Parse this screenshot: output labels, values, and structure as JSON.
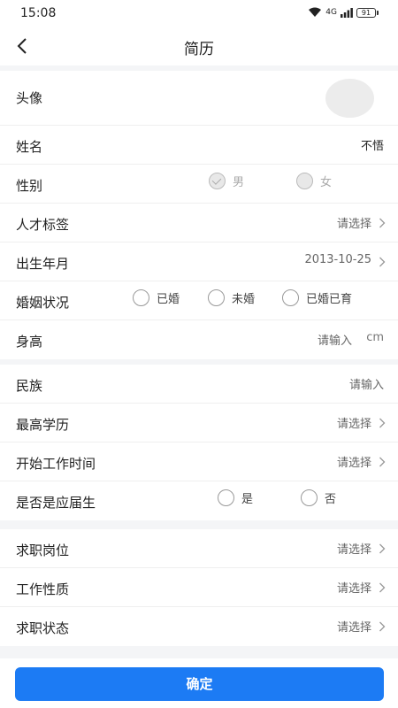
{
  "status_bar": {
    "time": "15:08",
    "network": "4G",
    "battery": "91"
  },
  "nav": {
    "title": "简历"
  },
  "basic": {
    "avatar_label": "头像",
    "name_label": "姓名",
    "name_value": "不悟",
    "gender_label": "性别",
    "gender_options": [
      "男",
      "女"
    ],
    "gender_selected": "男",
    "talent_tag_label": "人才标签",
    "talent_tag_placeholder": "请选择",
    "birth_label": "出生年月",
    "birth_value": "2013-10-25",
    "marital_label": "婚姻状况",
    "marital_options": [
      "已婚",
      "未婚",
      "已婚已育"
    ],
    "height_label": "身高",
    "height_placeholder": "请输入",
    "height_unit": "cm"
  },
  "education": {
    "ethnicity_label": "民族",
    "ethnicity_placeholder": "请输入",
    "degree_label": "最高学历",
    "degree_placeholder": "请选择",
    "work_start_label": "开始工作时间",
    "work_start_placeholder": "请选择",
    "graduate_label": "是否是应届生",
    "graduate_options": [
      "是",
      "否"
    ]
  },
  "job": {
    "position_label": "求职岗位",
    "position_placeholder": "请选择",
    "nature_label": "工作性质",
    "nature_placeholder": "请选择",
    "status_label": "求职状态",
    "status_placeholder": "请选择"
  },
  "footer": {
    "confirm_label": "确定"
  },
  "colors": {
    "accent": "#1c7bf4",
    "background": "#f4f5f7"
  }
}
